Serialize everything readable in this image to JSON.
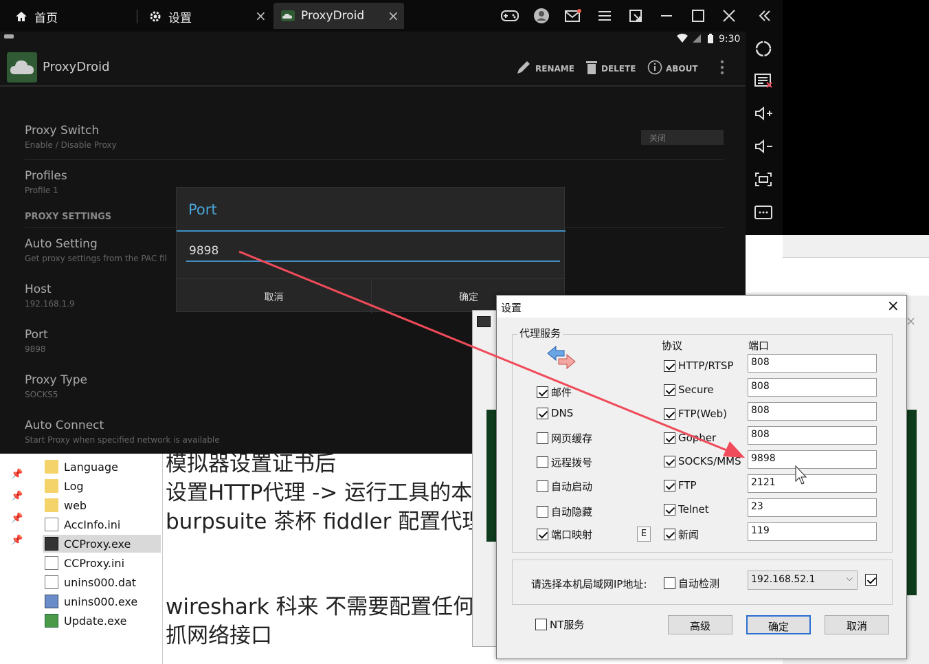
{
  "emulator": {
    "tabs": [
      {
        "label": "首页",
        "icon": "home-icon"
      },
      {
        "label": "设置",
        "icon": "gear-icon"
      },
      {
        "label": "ProxyDroid",
        "icon": "cloud-icon"
      }
    ],
    "window_controls": [
      "gamepad-icon",
      "avatar-icon",
      "mail-icon",
      "menu-icon",
      "screenshot-icon",
      "minimize-icon",
      "maximize-icon",
      "close-icon",
      "collapse-icon"
    ],
    "sidebar_icons": [
      "rotate-icon",
      "keyboard-icon",
      "volume-up-icon",
      "volume-down-icon",
      "fullscreen-icon",
      "more-icon"
    ]
  },
  "android": {
    "status_time": "9:30",
    "app_title": "ProxyDroid",
    "actions": {
      "rename": "RENAME",
      "delete": "DELETE",
      "about": "ABOUT"
    },
    "prefs": {
      "proxy_switch": {
        "title": "Proxy Switch",
        "summary": "Enable / Disable Proxy",
        "toggle": "关闭"
      },
      "profiles": {
        "title": "Profiles",
        "summary": "Profile 1"
      },
      "section": "PROXY SETTINGS",
      "auto_setting": {
        "title": "Auto Setting",
        "summary": "Get proxy settings from the PAC fil"
      },
      "host": {
        "title": "Host",
        "summary": "192.168.1.9"
      },
      "port": {
        "title": "Port",
        "summary": "9898"
      },
      "proxy_type": {
        "title": "Proxy Type",
        "summary": "SOCKS5"
      },
      "auto_connect": {
        "title": "Auto Connect",
        "summary": "Start Proxy when specified network is available"
      }
    },
    "port_dialog": {
      "title": "Port",
      "value": "9898",
      "cancel": "取消",
      "ok": "确定"
    }
  },
  "explorer": {
    "files": [
      {
        "name": "Language",
        "type": "folder"
      },
      {
        "name": "Log",
        "type": "folder"
      },
      {
        "name": "web",
        "type": "folder"
      },
      {
        "name": "AccInfo.ini",
        "type": "ini"
      },
      {
        "name": "CCProxy.exe",
        "type": "exe",
        "selected": true
      },
      {
        "name": "CCProxy.ini",
        "type": "ini"
      },
      {
        "name": "unins000.dat",
        "type": "dat"
      },
      {
        "name": "unins000.exe",
        "type": "exe"
      },
      {
        "name": "Update.exe",
        "type": "exe"
      }
    ]
  },
  "notes": {
    "line1": "模拟器设置证书后",
    "line2": "设置HTTP代理 -> 运行工具的本",
    "line3": "burpsuite 茶杯 fiddler 配置代理",
    "line4": "wireshark 科来 不需要配置任何",
    "line5": "抓网络接口"
  },
  "ccproxy": {
    "title": "设置",
    "group_label": "代理服务",
    "protocol_header": "协议",
    "port_header": "端口",
    "left_options": [
      {
        "label": "邮件",
        "checked": true
      },
      {
        "label": "DNS",
        "checked": true
      },
      {
        "label": "网页缓存",
        "checked": false
      },
      {
        "label": "远程拨号",
        "checked": false
      },
      {
        "label": "自动启动",
        "checked": false
      },
      {
        "label": "自动隐藏",
        "checked": false
      },
      {
        "label": "端口映射",
        "checked": true
      }
    ],
    "e_button": "E",
    "protocols": [
      {
        "label": "HTTP/RTSP",
        "port": "808",
        "checked": true
      },
      {
        "label": "Secure",
        "port": "808",
        "checked": true
      },
      {
        "label": "FTP(Web)",
        "port": "808",
        "checked": true
      },
      {
        "label": "Gopher",
        "port": "808",
        "checked": true
      },
      {
        "label": "SOCKS/MMS",
        "port": "9898",
        "checked": true
      },
      {
        "label": "FTP",
        "port": "2121",
        "checked": true
      },
      {
        "label": "Telnet",
        "port": "23",
        "checked": true
      },
      {
        "label": "新闻",
        "port": "119",
        "checked": true
      }
    ],
    "ip_label": "请选择本机局域网IP地址:",
    "auto_detect": "自动检测",
    "ip_value": "192.168.52.1",
    "nt_service": "NT服务",
    "buttons": {
      "advanced": "高级",
      "ok": "确定",
      "cancel": "取消"
    }
  },
  "colors": {
    "accent_blue": "#3f8fc4",
    "arrow_red": "#f04b5a",
    "android_bg": "#141414"
  }
}
